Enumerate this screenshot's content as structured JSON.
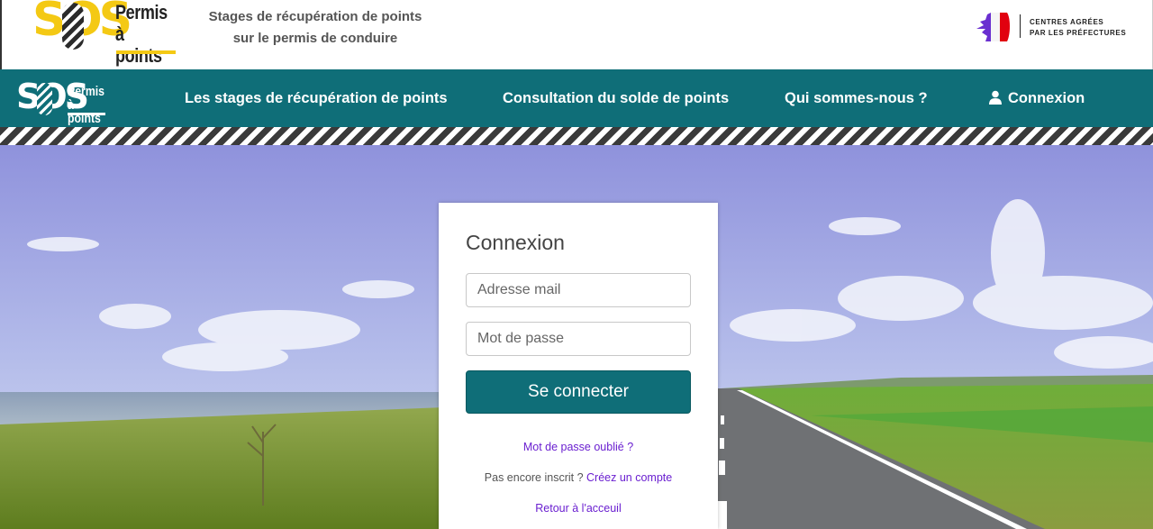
{
  "header": {
    "logo": {
      "word": "SOS",
      "line1": "Permis",
      "line2": "à points"
    },
    "tagline_line1": "Stages de récupération de points",
    "tagline_line2": "sur le permis de conduire",
    "prefecture_line1": "CENTRES AGRÉES",
    "prefecture_line2": "PAR LES PRÉFECTURES"
  },
  "nav": {
    "logo": {
      "word": "SOS",
      "line1": "Permis",
      "line2": "à points"
    },
    "items": [
      {
        "label": "Les stages de récupération de points"
      },
      {
        "label": "Consultation du solde de points"
      },
      {
        "label": "Qui sommes-nous ?"
      },
      {
        "label": "Connexion",
        "icon": "user-icon"
      }
    ]
  },
  "login": {
    "title": "Connexion",
    "email_placeholder": "Adresse mail",
    "email_value": "",
    "password_placeholder": "Mot de passe",
    "password_value": "",
    "submit_label": "Se connecter",
    "forgot_label": "Mot de passe oublié ?",
    "register_prompt": "Pas encore inscrit ?",
    "register_label": "Créez un compte",
    "back_label": "Retour à l'acceuil"
  },
  "colors": {
    "brand_teal": "#0f6e78",
    "brand_yellow": "#f4c914",
    "link_purple": "#6a1fd0"
  }
}
